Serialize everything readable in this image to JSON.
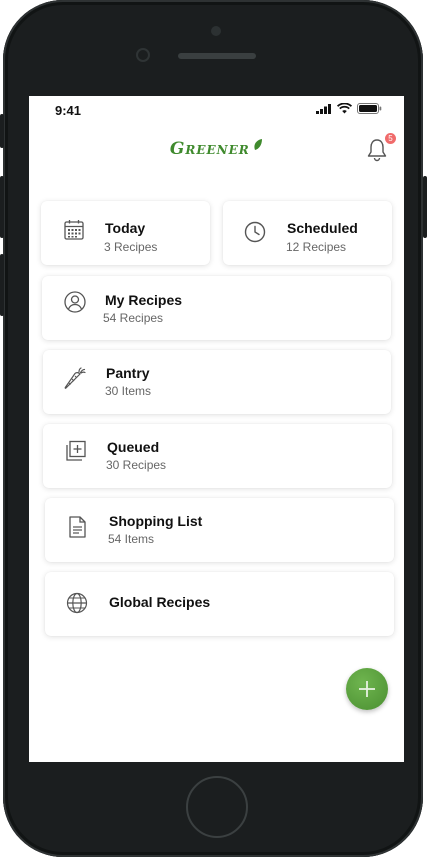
{
  "status": {
    "time": "9:41"
  },
  "header": {
    "logo": "Greener",
    "notifications_count": "5"
  },
  "tiles": {
    "today": {
      "title": "Today",
      "sub": "3 Recipes"
    },
    "scheduled": {
      "title": "Scheduled",
      "sub": "12 Recipes"
    },
    "my_recipes": {
      "title": "My Recipes",
      "sub": "54 Recipes"
    },
    "pantry": {
      "title": "Pantry",
      "sub": "30 Items"
    },
    "queued": {
      "title": "Queued",
      "sub": "30 Recipes"
    },
    "shopping_list": {
      "title": "Shopping List",
      "sub": "54 Items"
    },
    "global_recipes": {
      "title": "Global Recipes"
    }
  },
  "colors": {
    "brand": "#3f8a2d",
    "badge": "#f06b6b",
    "fab": "#5aa13d"
  },
  "icons": {
    "today": "calendar-icon",
    "scheduled": "clock-icon",
    "my_recipes": "user-circle-icon",
    "pantry": "carrot-icon",
    "queued": "queue-add-icon",
    "shopping_list": "document-list-icon",
    "global_recipes": "globe-icon",
    "fab": "plus-icon",
    "header": "bell-icon"
  }
}
